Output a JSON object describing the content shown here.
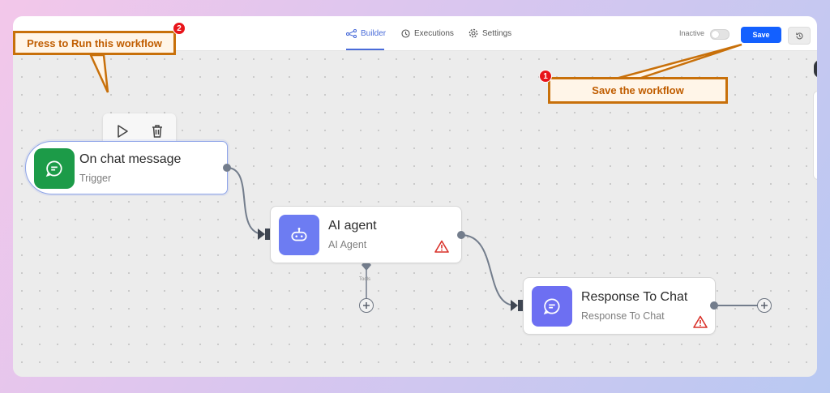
{
  "header": {
    "tabs": [
      {
        "label": "Builder",
        "icon": "workflow-icon",
        "active": true
      },
      {
        "label": "Executions",
        "icon": "clock-icon",
        "active": false
      },
      {
        "label": "Settings",
        "icon": "gear-icon",
        "active": false
      }
    ],
    "status_label": "Inactive",
    "save_label": "Save",
    "accent_color": "#1360ff"
  },
  "callouts": {
    "run": {
      "text": "Press to Run this workflow",
      "badge": "2"
    },
    "save": {
      "text": "Save the workflow",
      "badge": "1"
    }
  },
  "nodes": {
    "trigger": {
      "title": "On chat message",
      "subtitle": "Trigger",
      "icon": "chat-icon",
      "color": "#1c9b48"
    },
    "agent": {
      "title": "AI agent",
      "subtitle": "AI Agent",
      "icon": "robot-icon",
      "color": "#6d7cf2",
      "tools_label": "Tools"
    },
    "response": {
      "title": "Response To Chat",
      "subtitle": "Response To Chat",
      "icon": "chat-icon",
      "color": "#6d6ff2"
    }
  },
  "colors": {
    "callout_border": "#c8700a",
    "warning": "#d9322a",
    "connector": "#737d8c"
  }
}
